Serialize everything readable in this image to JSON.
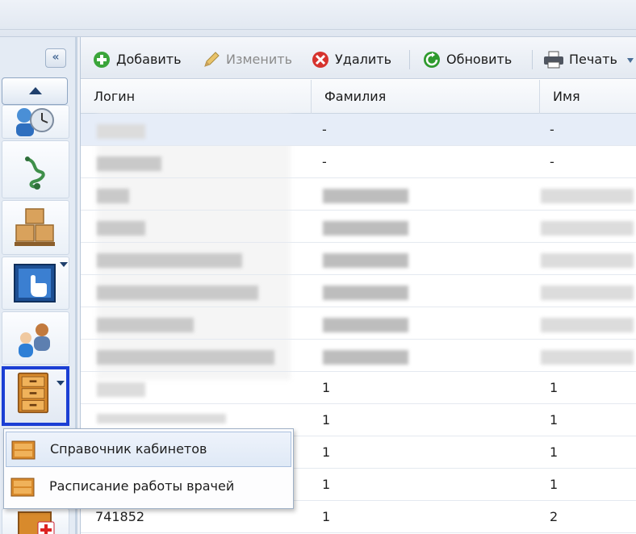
{
  "toolbar": {
    "add_label": "Добавить",
    "edit_label": "Изменить",
    "delete_label": "Удалить",
    "refresh_label": "Обновить",
    "print_label": "Печать"
  },
  "grid": {
    "columns": [
      "Логин",
      "Фамилия",
      "Имя"
    ],
    "rows": [
      {
        "login": "",
        "last_name": "-",
        "first_name": "-"
      },
      {
        "login": "",
        "last_name": "-",
        "first_name": "-"
      },
      {
        "login": "",
        "last_name": "",
        "first_name": ""
      },
      {
        "login": "",
        "last_name": "",
        "first_name": ""
      },
      {
        "login": "",
        "last_name": "",
        "first_name": ""
      },
      {
        "login": "",
        "last_name": "",
        "first_name": ""
      },
      {
        "login": "",
        "last_name": "",
        "first_name": ""
      },
      {
        "login": "",
        "last_name": "",
        "first_name": ""
      },
      {
        "login": "",
        "last_name": "1",
        "first_name": "1"
      },
      {
        "login": "",
        "last_name": "1",
        "first_name": "1"
      },
      {
        "login": "",
        "last_name": "1",
        "first_name": "1"
      },
      {
        "login": "",
        "last_name": "1",
        "first_name": "1"
      },
      {
        "login": "741852",
        "last_name": "1",
        "first_name": "2"
      }
    ]
  },
  "menu": {
    "items": [
      {
        "label": "Справочник кабинетов"
      },
      {
        "label": "Расписание работы врачей"
      }
    ]
  },
  "icons": {
    "collapse": "double-chevron-left-icon",
    "add": "plus-circle-icon",
    "edit": "pencil-icon",
    "delete": "x-circle-icon",
    "refresh": "refresh-icon",
    "print": "printer-icon"
  },
  "colors": {
    "selection_border": "#1b3fd4",
    "add_green": "#3aa53a",
    "delete_red": "#d6332e",
    "refresh_green": "#2e9a2e"
  }
}
